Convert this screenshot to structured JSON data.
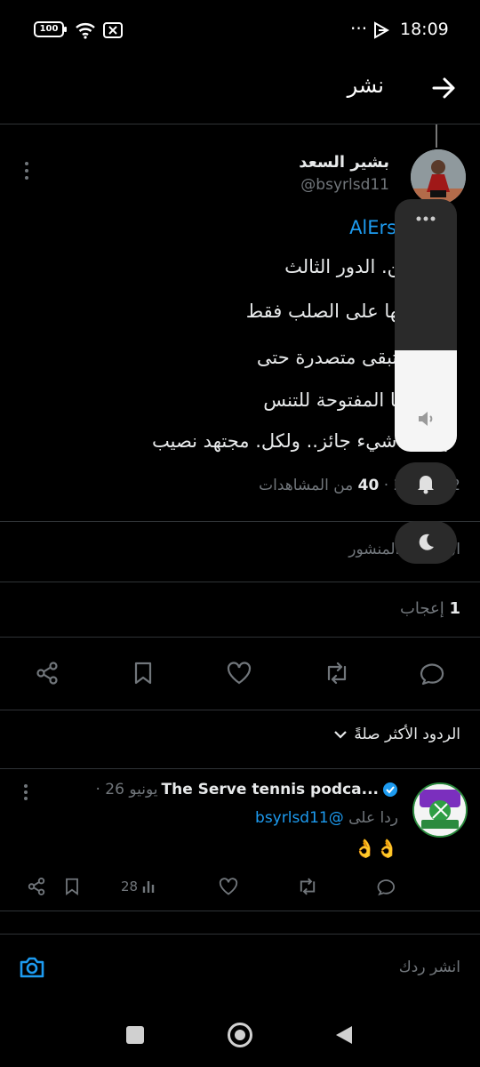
{
  "status_bar": {
    "battery": "100",
    "time": "18:09",
    "dots": "···"
  },
  "header": {
    "title": "نشر"
  },
  "tweet": {
    "author_name": "بشير السعد",
    "author_handle": "@bsyrlsd11",
    "lines": [
      "ر @AlErsalpo",
      "س ر من. الدور الثالث",
      "ر .. قوتها على الصلب فقط",
      "س س تبقى متصدرة حتى",
      "ب مريكا المفتوحة للتنس",
      "م . كل شيء جائز.. ولكل. مجتهد نصيب"
    ],
    "mention": "@AlErsalpo",
    "meta_date": "2 يونيو 26 ·",
    "meta_views_count": "40",
    "meta_views_label": "من المشاهدات",
    "activity": "ال نشاط المنشور",
    "likes_count": "1",
    "likes_label": "إعجاب"
  },
  "sort_label": "الردود الأكثر صلةً",
  "reply": {
    "name": "The Serve tennis podca...",
    "date": "· 26 يونيو",
    "replying_to_label": "ردا على",
    "replying_to_handle": "@bsyrlsd11",
    "text": "👌👌",
    "views": "28"
  },
  "compose": {
    "placeholder": "انشر ردك"
  },
  "colors": {
    "accent": "#1d9bf0",
    "background": "#000000",
    "muted": "#71767b",
    "divider": "#2f3336"
  },
  "icons": {
    "back": "arrow-right-icon",
    "more": "more-vertical-icon",
    "share": "share-icon",
    "bookmark": "bookmark-icon",
    "like": "heart-icon",
    "retweet": "retweet-icon",
    "reply": "comment-icon",
    "views": "bar-chart-icon",
    "camera": "camera-icon",
    "volume": "speaker-icon",
    "bell": "bell-icon",
    "dnd": "moon-icon"
  },
  "volume_level": 0.4
}
